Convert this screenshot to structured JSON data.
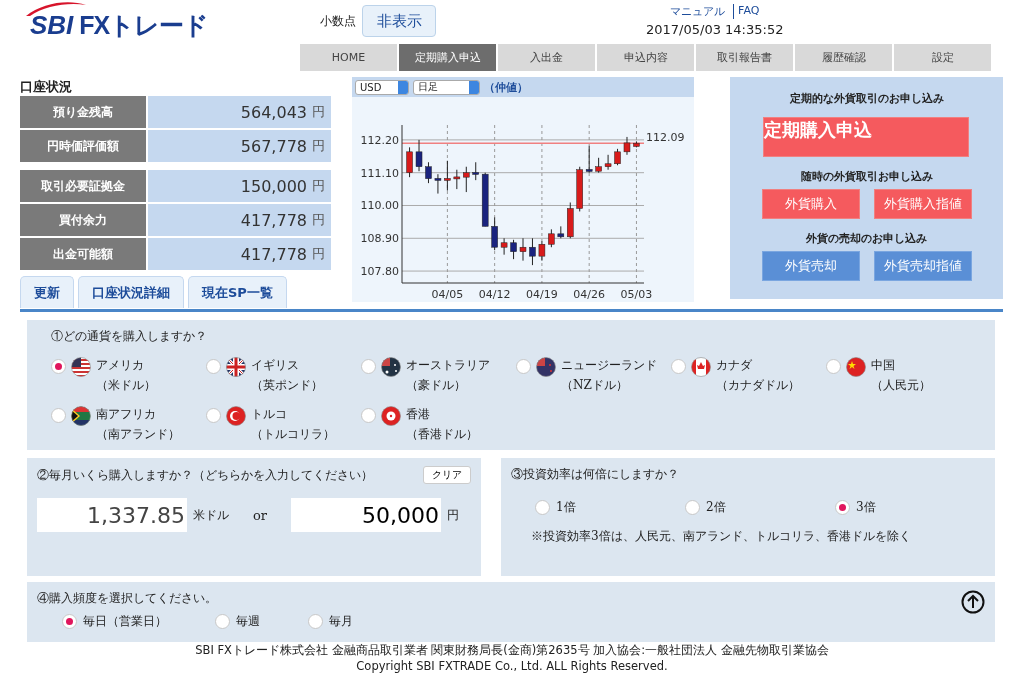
{
  "header": {
    "logo": {
      "brand": "SBI",
      "name": "FXトレード"
    },
    "decimal": {
      "label": "小数点",
      "button": "非表示"
    },
    "links": [
      "マニュアル",
      "FAQ"
    ],
    "datetime": "2017/05/03 14:35:52"
  },
  "nav": [
    {
      "label": "HOME",
      "selected": false
    },
    {
      "label": "定期購入申込",
      "selected": true
    },
    {
      "label": "入出金",
      "selected": false
    },
    {
      "label": "申込内容",
      "selected": false
    },
    {
      "label": "取引報告書",
      "selected": false
    },
    {
      "label": "履歴確認",
      "selected": false
    },
    {
      "label": "設定",
      "selected": false
    }
  ],
  "account": {
    "title": "口座状況",
    "groups": [
      [
        {
          "label": "預り金残高",
          "value": "564,043",
          "unit": "円"
        },
        {
          "label": "円時価評価額",
          "value": "567,778",
          "unit": "円"
        }
      ],
      [
        {
          "label": "取引必要証拠金",
          "value": "150,000",
          "unit": "円"
        },
        {
          "label": "買付余力",
          "value": "417,778",
          "unit": "円"
        },
        {
          "label": "出金可能額",
          "value": "417,778",
          "unit": "円"
        }
      ]
    ],
    "buttons": [
      "更新",
      "口座状況詳細",
      "現在SP一覧"
    ]
  },
  "chart": {
    "currency": "USD",
    "period": "日足",
    "rate_type": "（仲値）",
    "chart_data": {
      "type": "candlestick",
      "categories": [
        null,
        null,
        null,
        null,
        "04/05",
        null,
        null,
        null,
        null,
        "04/12",
        null,
        null,
        null,
        null,
        "04/19",
        null,
        null,
        null,
        null,
        "04/26",
        null,
        null,
        null,
        null,
        "05/03"
      ],
      "ohlc": [
        [
          111.1,
          111.95,
          110.95,
          111.8
        ],
        [
          111.8,
          112.2,
          111.15,
          111.3
        ],
        [
          111.3,
          111.45,
          110.75,
          110.9
        ],
        [
          110.9,
          111.05,
          110.4,
          110.85
        ],
        [
          110.85,
          111.5,
          110.5,
          110.9
        ],
        [
          110.9,
          111.2,
          110.55,
          110.95
        ],
        [
          110.95,
          111.3,
          110.45,
          111.1
        ],
        [
          111.1,
          111.45,
          110.85,
          111.05
        ],
        [
          111.05,
          111.1,
          109.3,
          109.3
        ],
        [
          109.3,
          109.6,
          108.5,
          108.6
        ],
        [
          108.6,
          108.9,
          108.35,
          108.75
        ],
        [
          108.75,
          108.85,
          108.2,
          108.45
        ],
        [
          108.45,
          108.9,
          108.15,
          108.6
        ],
        [
          108.6,
          108.9,
          108.0,
          108.3
        ],
        [
          108.3,
          108.8,
          108.15,
          108.7
        ],
        [
          108.7,
          109.2,
          108.6,
          109.05
        ],
        [
          109.05,
          109.3,
          108.9,
          108.95
        ],
        [
          108.95,
          110.1,
          108.9,
          109.9
        ],
        [
          109.9,
          111.3,
          109.8,
          111.2
        ],
        [
          111.2,
          112.0,
          111.1,
          111.15
        ],
        [
          111.15,
          111.6,
          111.1,
          111.3
        ],
        [
          111.3,
          111.7,
          111.2,
          111.4
        ],
        [
          111.4,
          111.9,
          111.35,
          111.8
        ],
        [
          111.8,
          112.3,
          111.7,
          112.1
        ],
        [
          111.98,
          112.15,
          111.95,
          112.09
        ]
      ],
      "ylim": [
        107.4,
        112.7
      ],
      "grid": true,
      "yticks": [
        {
          "value": 107.8,
          "label": "107.80"
        },
        {
          "value": 108.9,
          "label": "108.90"
        },
        {
          "value": 110.0,
          "label": "110.00"
        },
        {
          "value": 111.1,
          "label": "111.10"
        },
        {
          "value": 112.2,
          "label": "112.20"
        }
      ],
      "ref_lines": [
        {
          "axis": "y",
          "value": 112.09,
          "label": "112.09",
          "color": "#f08080"
        }
      ]
    }
  },
  "order_panel": [
    {
      "heading": "定期的な外貨取引のお申し込み",
      "buttons": [
        {
          "label": "定期購入申込",
          "kind": "main"
        }
      ]
    },
    {
      "heading": "随時の外貨取引お申し込み",
      "buttons": [
        {
          "label": "外貨購入",
          "kind": "buy"
        },
        {
          "label": "外貨購入指値",
          "kind": "buy"
        }
      ]
    },
    {
      "heading": "外貨の売却のお申し込み",
      "buttons": [
        {
          "label": "外貨売却",
          "kind": "sell"
        },
        {
          "label": "外貨売却指値",
          "kind": "sell"
        }
      ]
    }
  ],
  "q1": {
    "title": "①どの通貨を購入しますか？",
    "currencies": [
      {
        "name": "アメリカ",
        "unit": "（米ドル）",
        "kind": "us",
        "selected": true
      },
      {
        "name": "イギリス",
        "unit": "（英ポンド）",
        "kind": "gb",
        "selected": false
      },
      {
        "name": "オーストラリア",
        "unit": "（豪ドル）",
        "kind": "au",
        "selected": false
      },
      {
        "name": "ニュージーランド",
        "unit": "（NZドル）",
        "kind": "nz",
        "selected": false
      },
      {
        "name": "カナダ",
        "unit": "（カナダドル）",
        "kind": "ca",
        "selected": false
      },
      {
        "name": "中国",
        "unit": "（人民元）",
        "kind": "cn",
        "selected": false
      },
      {
        "name": "南アフリカ",
        "unit": "（南アランド）",
        "kind": "za",
        "selected": false
      },
      {
        "name": "トルコ",
        "unit": "（トルコリラ）",
        "kind": "tr",
        "selected": false
      },
      {
        "name": "香港",
        "unit": "（香港ドル）",
        "kind": "hk",
        "selected": false
      }
    ]
  },
  "q2": {
    "title": "②毎月いくら購入しますか？（どちらかを入力してください）",
    "clear_button": "クリア",
    "foreign_value": "1,337.85",
    "foreign_unit": "米ドル",
    "or": "or",
    "yen_value": "50,000",
    "yen_unit": "円"
  },
  "q3": {
    "title": "③投資効率は何倍にしますか？",
    "options": [
      {
        "label": "1倍",
        "selected": false
      },
      {
        "label": "2倍",
        "selected": false
      },
      {
        "label": "3倍",
        "selected": true
      }
    ],
    "note": "※投資効率3倍は、人民元、南アランド、トルコリラ、香港ドルを除く"
  },
  "q4": {
    "title": "④購入頻度を選択してください。",
    "options": [
      {
        "label": "毎日（営業日）",
        "selected": true
      },
      {
        "label": "毎週",
        "selected": false
      },
      {
        "label": "毎月",
        "selected": false
      }
    ]
  },
  "footer": [
    "SBI FXトレード株式会社 金融商品取引業者 関東財務局長(金商)第2635号 加入協会:一般社団法人 金融先物取引業協会",
    "Copyright SBI FXTRADE Co., Ltd. ALL Rights Reserved."
  ]
}
